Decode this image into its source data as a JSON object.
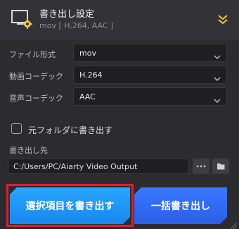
{
  "header": {
    "title": "書き出し設定",
    "subtitle": "mov [ H.264, AAC ]"
  },
  "settings": {
    "file_format": {
      "label": "ファイル形式",
      "value": "mov"
    },
    "video_codec": {
      "label": "動画コーデック",
      "value": "H.264"
    },
    "audio_codec": {
      "label": "音声コーデック",
      "value": "AAC"
    }
  },
  "original_folder": {
    "label": "元フォルダに書き出す",
    "checked": false
  },
  "output": {
    "label": "書き出し先",
    "path": "C:/Users/PC/Aiarty Video Output",
    "more_icon_text": "···"
  },
  "buttons": {
    "export_selected": "選択項目を書き出す",
    "export_all": "一括書き出し"
  },
  "colors": {
    "accent_yellow": "#f5c542",
    "highlight_red": "#e01e2a",
    "button_blue": "#1f9bff",
    "button_indigo": "#336cf5"
  }
}
